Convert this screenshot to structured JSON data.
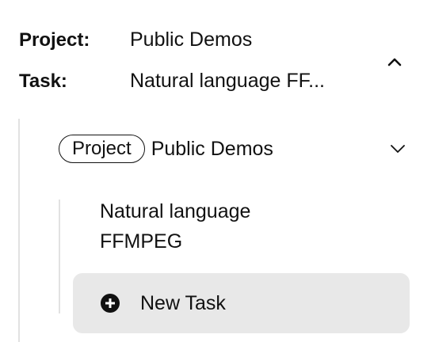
{
  "summary": {
    "project_key": "Project:",
    "project_value": "Public Demos",
    "task_key": "Task:",
    "task_value": "Natural language FF..."
  },
  "collapse_icon": "chevron-up-icon",
  "project": {
    "badge": "Project",
    "name": "Public Demos",
    "dropdown_icon": "chevron-down-icon"
  },
  "tasks": [
    {
      "label_line1": "Natural language",
      "label_line2": "FFMPEG"
    }
  ],
  "new_task": {
    "icon": "plus-circle-icon",
    "label": "New Task"
  }
}
